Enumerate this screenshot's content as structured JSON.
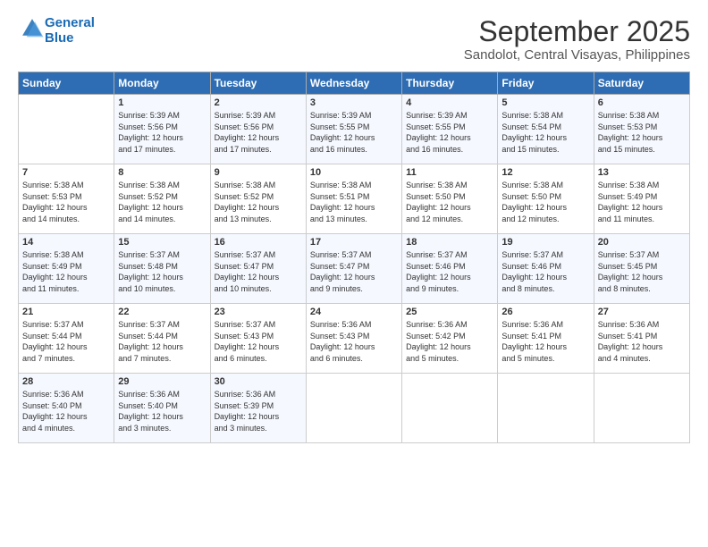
{
  "header": {
    "logo_line1": "General",
    "logo_line2": "Blue",
    "month_title": "September 2025",
    "location": "Sandolot, Central Visayas, Philippines"
  },
  "weekdays": [
    "Sunday",
    "Monday",
    "Tuesday",
    "Wednesday",
    "Thursday",
    "Friday",
    "Saturday"
  ],
  "weeks": [
    [
      {
        "day": "",
        "info": ""
      },
      {
        "day": "1",
        "info": "Sunrise: 5:39 AM\nSunset: 5:56 PM\nDaylight: 12 hours\nand 17 minutes."
      },
      {
        "day": "2",
        "info": "Sunrise: 5:39 AM\nSunset: 5:56 PM\nDaylight: 12 hours\nand 17 minutes."
      },
      {
        "day": "3",
        "info": "Sunrise: 5:39 AM\nSunset: 5:55 PM\nDaylight: 12 hours\nand 16 minutes."
      },
      {
        "day": "4",
        "info": "Sunrise: 5:39 AM\nSunset: 5:55 PM\nDaylight: 12 hours\nand 16 minutes."
      },
      {
        "day": "5",
        "info": "Sunrise: 5:38 AM\nSunset: 5:54 PM\nDaylight: 12 hours\nand 15 minutes."
      },
      {
        "day": "6",
        "info": "Sunrise: 5:38 AM\nSunset: 5:53 PM\nDaylight: 12 hours\nand 15 minutes."
      }
    ],
    [
      {
        "day": "7",
        "info": "Sunrise: 5:38 AM\nSunset: 5:53 PM\nDaylight: 12 hours\nand 14 minutes."
      },
      {
        "day": "8",
        "info": "Sunrise: 5:38 AM\nSunset: 5:52 PM\nDaylight: 12 hours\nand 14 minutes."
      },
      {
        "day": "9",
        "info": "Sunrise: 5:38 AM\nSunset: 5:52 PM\nDaylight: 12 hours\nand 13 minutes."
      },
      {
        "day": "10",
        "info": "Sunrise: 5:38 AM\nSunset: 5:51 PM\nDaylight: 12 hours\nand 13 minutes."
      },
      {
        "day": "11",
        "info": "Sunrise: 5:38 AM\nSunset: 5:50 PM\nDaylight: 12 hours\nand 12 minutes."
      },
      {
        "day": "12",
        "info": "Sunrise: 5:38 AM\nSunset: 5:50 PM\nDaylight: 12 hours\nand 12 minutes."
      },
      {
        "day": "13",
        "info": "Sunrise: 5:38 AM\nSunset: 5:49 PM\nDaylight: 12 hours\nand 11 minutes."
      }
    ],
    [
      {
        "day": "14",
        "info": "Sunrise: 5:38 AM\nSunset: 5:49 PM\nDaylight: 12 hours\nand 11 minutes."
      },
      {
        "day": "15",
        "info": "Sunrise: 5:37 AM\nSunset: 5:48 PM\nDaylight: 12 hours\nand 10 minutes."
      },
      {
        "day": "16",
        "info": "Sunrise: 5:37 AM\nSunset: 5:47 PM\nDaylight: 12 hours\nand 10 minutes."
      },
      {
        "day": "17",
        "info": "Sunrise: 5:37 AM\nSunset: 5:47 PM\nDaylight: 12 hours\nand 9 minutes."
      },
      {
        "day": "18",
        "info": "Sunrise: 5:37 AM\nSunset: 5:46 PM\nDaylight: 12 hours\nand 9 minutes."
      },
      {
        "day": "19",
        "info": "Sunrise: 5:37 AM\nSunset: 5:46 PM\nDaylight: 12 hours\nand 8 minutes."
      },
      {
        "day": "20",
        "info": "Sunrise: 5:37 AM\nSunset: 5:45 PM\nDaylight: 12 hours\nand 8 minutes."
      }
    ],
    [
      {
        "day": "21",
        "info": "Sunrise: 5:37 AM\nSunset: 5:44 PM\nDaylight: 12 hours\nand 7 minutes."
      },
      {
        "day": "22",
        "info": "Sunrise: 5:37 AM\nSunset: 5:44 PM\nDaylight: 12 hours\nand 7 minutes."
      },
      {
        "day": "23",
        "info": "Sunrise: 5:37 AM\nSunset: 5:43 PM\nDaylight: 12 hours\nand 6 minutes."
      },
      {
        "day": "24",
        "info": "Sunrise: 5:36 AM\nSunset: 5:43 PM\nDaylight: 12 hours\nand 6 minutes."
      },
      {
        "day": "25",
        "info": "Sunrise: 5:36 AM\nSunset: 5:42 PM\nDaylight: 12 hours\nand 5 minutes."
      },
      {
        "day": "26",
        "info": "Sunrise: 5:36 AM\nSunset: 5:41 PM\nDaylight: 12 hours\nand 5 minutes."
      },
      {
        "day": "27",
        "info": "Sunrise: 5:36 AM\nSunset: 5:41 PM\nDaylight: 12 hours\nand 4 minutes."
      }
    ],
    [
      {
        "day": "28",
        "info": "Sunrise: 5:36 AM\nSunset: 5:40 PM\nDaylight: 12 hours\nand 4 minutes."
      },
      {
        "day": "29",
        "info": "Sunrise: 5:36 AM\nSunset: 5:40 PM\nDaylight: 12 hours\nand 3 minutes."
      },
      {
        "day": "30",
        "info": "Sunrise: 5:36 AM\nSunset: 5:39 PM\nDaylight: 12 hours\nand 3 minutes."
      },
      {
        "day": "",
        "info": ""
      },
      {
        "day": "",
        "info": ""
      },
      {
        "day": "",
        "info": ""
      },
      {
        "day": "",
        "info": ""
      }
    ]
  ]
}
